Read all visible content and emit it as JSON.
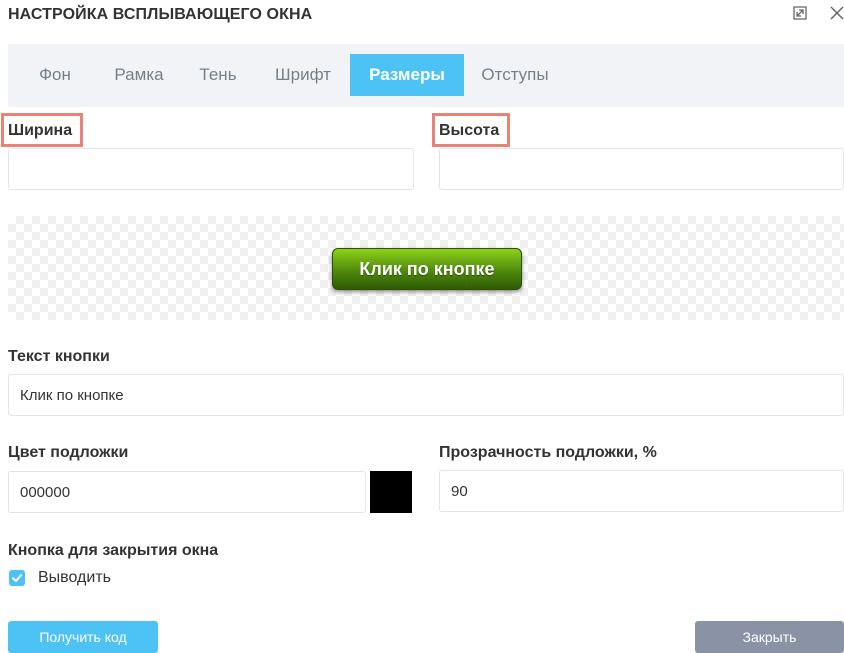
{
  "dialog": {
    "title": "НАСТРОЙКА ВСПЛЫВАЮЩЕГО ОКНА",
    "icons": {
      "expand": "expand-icon",
      "close": "close-icon"
    }
  },
  "tabs": [
    {
      "label": "Фон",
      "active": false
    },
    {
      "label": "Рамка",
      "active": false
    },
    {
      "label": "Тень",
      "active": false
    },
    {
      "label": "Шрифт",
      "active": false
    },
    {
      "label": "Размеры",
      "active": true
    },
    {
      "label": "Отступы",
      "active": false
    }
  ],
  "size": {
    "width_label": "Ширина",
    "width_value": "",
    "height_label": "Высота",
    "height_value": ""
  },
  "preview": {
    "button_text": "Клик по кнопке"
  },
  "button_text_field": {
    "label": "Текст кнопки",
    "value": "Клик по кнопке"
  },
  "overlay": {
    "color_label": "Цвет подложки",
    "color_value": "000000",
    "swatch_color": "#000000",
    "opacity_label": "Прозрачность подложки, %",
    "opacity_value": "90"
  },
  "close_button_option": {
    "label": "Кнопка для закрытия окна",
    "checkbox_label": "Выводить",
    "checked": true
  },
  "actions": {
    "get_code": "Получить код",
    "close": "Закрыть"
  },
  "colors": {
    "accent": "#4dc3f5",
    "highlight": "#e8837a",
    "close_button": "#8a93a6",
    "tab_bar": "#f1f3f6"
  }
}
